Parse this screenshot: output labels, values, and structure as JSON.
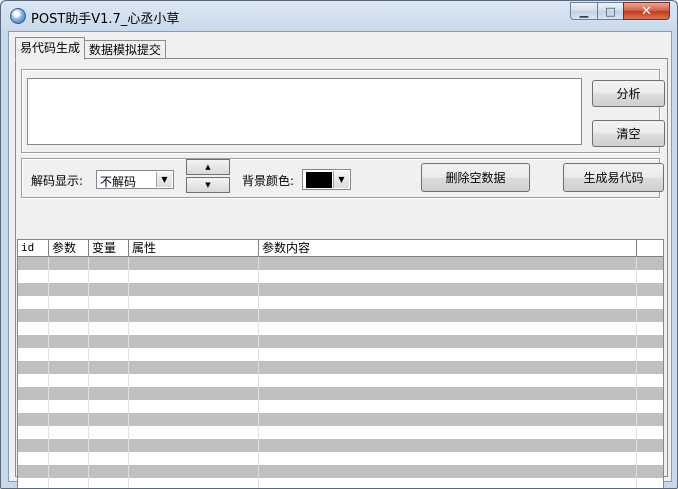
{
  "window": {
    "title": "POST助手V1.7_心丞小草",
    "min_glyph": "▁",
    "max_glyph": "□",
    "close_glyph": "✕"
  },
  "tabs": [
    {
      "label": "易代码生成",
      "active": true
    },
    {
      "label": "数据模拟提交",
      "active": false
    }
  ],
  "top": {
    "input_value": "",
    "analyze_label": "分析",
    "clear_label": "清空"
  },
  "controls": {
    "decode_label": "解码显示:",
    "decode_value": "不解码",
    "spin_up": "▲",
    "spin_down": "▼",
    "bgcolor_label": "背景颜色:",
    "bgcolor_value": "#000000",
    "delete_empty_label": "删除空数据",
    "generate_label": "生成易代码"
  },
  "table": {
    "columns": [
      "id",
      "参数",
      "变量",
      "属性",
      "参数内容"
    ],
    "row_count": 18,
    "stripe_color": "#c0c0c0"
  }
}
